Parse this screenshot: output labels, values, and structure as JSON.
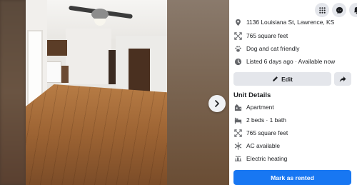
{
  "listing": {
    "address": "1136 Louisiana St, Lawrence, KS",
    "square_feet": "765 square feet",
    "pets": "Dog and cat friendly",
    "listed": "Listed 6 days ago · Available now"
  },
  "actions": {
    "edit_label": "Edit",
    "mark_rented_label": "Mark as rented"
  },
  "unit_details": {
    "title": "Unit Details",
    "items": [
      {
        "icon": "apartment-icon",
        "label": "Apartment"
      },
      {
        "icon": "bed-icon",
        "label": "2 beds · 1 bath"
      },
      {
        "icon": "area-icon",
        "label": "765 square feet"
      },
      {
        "icon": "snowflake-icon",
        "label": "AC available"
      },
      {
        "icon": "heating-icon",
        "label": "Electric heating"
      }
    ]
  },
  "colors": {
    "accent": "#1877f2",
    "button_gray": "#e4e6eb",
    "text": "#1c1e21"
  }
}
